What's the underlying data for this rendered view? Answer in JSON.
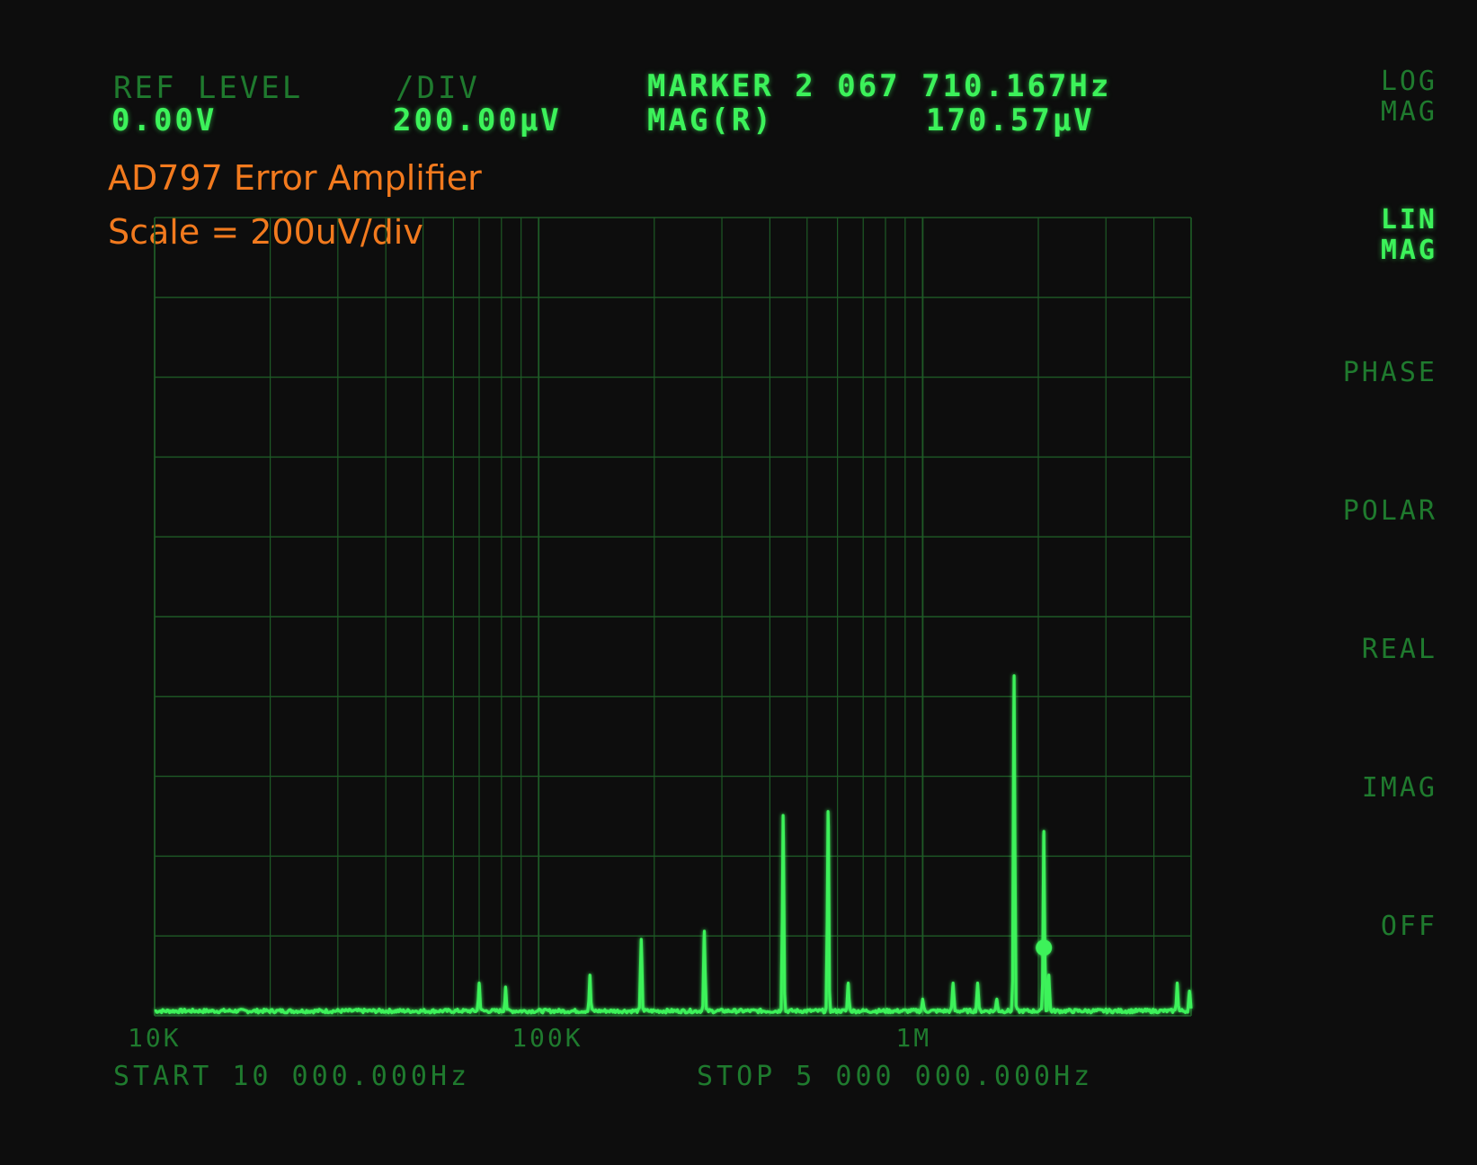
{
  "header": {
    "ref_level_label": "REF LEVEL",
    "ref_level_value": "0.00V",
    "div_label": "/DIV",
    "div_value": "200.00µV",
    "marker_label": "MARKER 2 067 710.167Hz",
    "mag_label": "MAG(R)",
    "mag_value": "170.57µV"
  },
  "annotation": {
    "line1": "AD797 Error Amplifier",
    "line2": "Scale = 200uV/div"
  },
  "softkeys": [
    {
      "line1": "LOG",
      "line2": "MAG",
      "active": false
    },
    {
      "line1": "LIN",
      "line2": "MAG",
      "active": true
    },
    {
      "line1": "PHASE",
      "line2": "",
      "active": false
    },
    {
      "line1": "POLAR",
      "line2": "",
      "active": false
    },
    {
      "line1": "REAL",
      "line2": "",
      "active": false
    },
    {
      "line1": "IMAG",
      "line2": "",
      "active": false
    },
    {
      "line1": "OFF",
      "line2": "",
      "active": false
    }
  ],
  "footer": {
    "start": "START 10 000.000Hz",
    "stop": "STOP 5 000 000.000Hz"
  },
  "colors": {
    "trace": "#3cf25a",
    "grid": "#1e5a26",
    "annotation": "#f27a1e",
    "background": "#0d0d0d"
  },
  "chart_data": {
    "type": "line",
    "x_scale": "log",
    "xlim": [
      10000,
      5000000
    ],
    "ylim": [
      0,
      0.002
    ],
    "y_unit": "V",
    "grid": true,
    "tick_labels": [
      {
        "x": 10000,
        "label": "10K"
      },
      {
        "x": 100000,
        "label": "100K"
      },
      {
        "x": 1000000,
        "label": "1M"
      }
    ],
    "marker": {
      "x": 2067710.167,
      "y": 0.00017057
    },
    "noise_floor": 1.2e-05,
    "peaks": [
      {
        "x": 70000,
        "y": 7e-05
      },
      {
        "x": 82000,
        "y": 6e-05
      },
      {
        "x": 136000,
        "y": 9e-05
      },
      {
        "x": 185000,
        "y": 0.00018
      },
      {
        "x": 270000,
        "y": 0.0002
      },
      {
        "x": 433000,
        "y": 0.00049
      },
      {
        "x": 567000,
        "y": 0.0005
      },
      {
        "x": 640000,
        "y": 7e-05
      },
      {
        "x": 1000000,
        "y": 3e-05
      },
      {
        "x": 1200000,
        "y": 7e-05
      },
      {
        "x": 1390000,
        "y": 7e-05
      },
      {
        "x": 1560000,
        "y": 3e-05
      },
      {
        "x": 1730000,
        "y": 0.00084
      },
      {
        "x": 2067710,
        "y": 0.00045
      },
      {
        "x": 2130000,
        "y": 9e-05
      },
      {
        "x": 4600000,
        "y": 7e-05
      },
      {
        "x": 4950000,
        "y": 5e-05
      }
    ]
  }
}
